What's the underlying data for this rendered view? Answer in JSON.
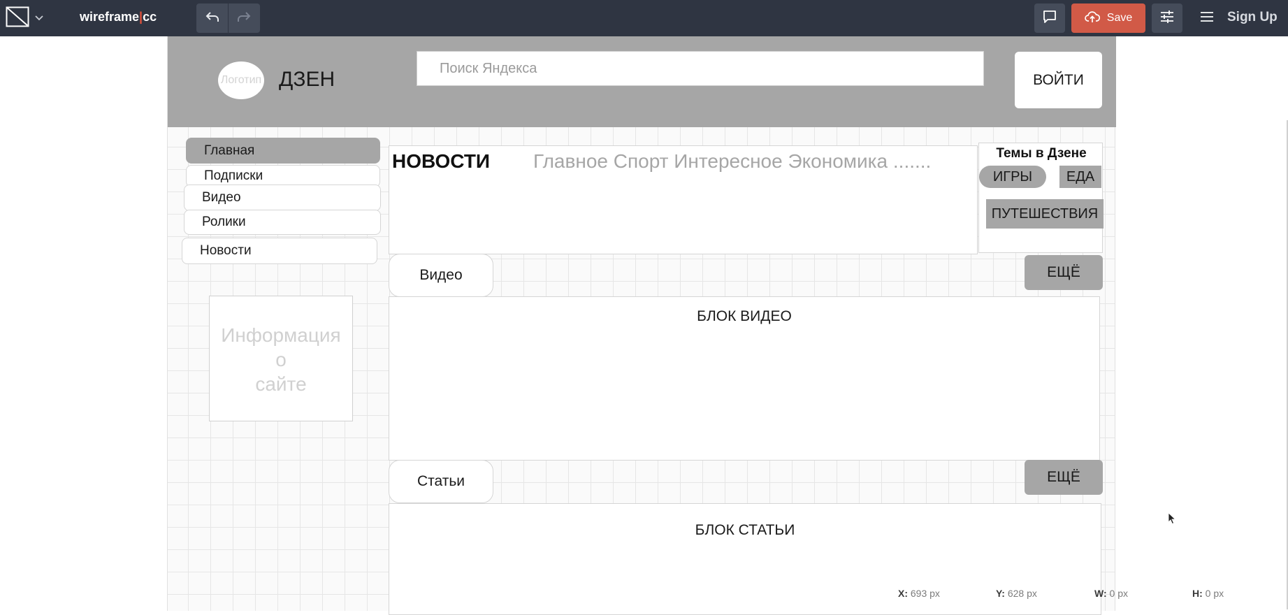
{
  "app": {
    "brand_left": "wireframe",
    "brand_right": "cc",
    "save_label": "Save",
    "signup_label": "Sign Up",
    "icons": {
      "logo": "diagonal-square-icon",
      "dropdown": "chevron-down-icon",
      "undo": "undo-arrow-icon",
      "redo": "redo-arrow-icon",
      "comment": "comment-icon",
      "save": "cloud-upload-icon",
      "settings": "sliders-icon",
      "menu": "hamburger-icon"
    },
    "colors": {
      "topbar": "#2f3542",
      "save_button": "#d15a47",
      "brand_bar": "#e2513b"
    }
  },
  "wireframe": {
    "logo_text": "Логотип",
    "site_title": "ДЗЕН",
    "search_placeholder": "Поиск Яндекса",
    "login_label": "ВОЙТИ",
    "sidebar": {
      "items": [
        {
          "label": "Главная"
        },
        {
          "label": "Подписки"
        },
        {
          "label": "Видео"
        },
        {
          "label": "Ролики"
        },
        {
          "label": "Новости"
        }
      ]
    },
    "info_box": {
      "lines": [
        "Информация",
        "о",
        "сайте"
      ]
    },
    "news": {
      "title": "НОВОСТИ",
      "categories": "Главное Спорт Интересное Экономика ......."
    },
    "themes": {
      "title": "Темы в Дзене",
      "chips": [
        "ИГРЫ",
        "ЕДА",
        "ПУТЕШЕСТВИЯ"
      ]
    },
    "video_section": {
      "pill": "Видео",
      "more": "ЕЩЁ",
      "block": "БЛОК ВИДЕО"
    },
    "articles_section": {
      "pill": "Статьи",
      "more": "ЕЩЁ",
      "block": "БЛОК СТАТЬИ"
    },
    "colors": {
      "header_strip": "#a6a6a6",
      "active_item": "#a6a6a6",
      "muted_text": "#a6a6a6"
    }
  },
  "status": {
    "x_label": "X:",
    "x_value": "693 px",
    "y_label": "Y:",
    "y_value": "628 px",
    "w_label": "W:",
    "w_value": "0 px",
    "h_label": "H:",
    "h_value": "0 px"
  }
}
